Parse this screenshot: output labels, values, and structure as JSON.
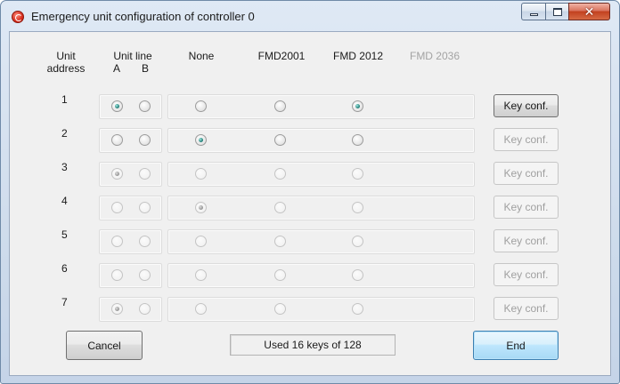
{
  "window": {
    "title": "Emergency unit configuration of controller 0",
    "accent_color": "#c5d4e8",
    "close_color": "#c2401f"
  },
  "headers": {
    "unit_address_line1": "Unit",
    "unit_address_line2": "address",
    "unit_line": "Unit line",
    "line_a": "A",
    "line_b": "B",
    "type_none": "None",
    "type_fmd2001": "FMD2001",
    "type_fmd2012": "FMD 2012",
    "type_fmd2036": "FMD 2036"
  },
  "rows": [
    {
      "address": "1",
      "unit_line": "A",
      "type": "FMD 2012",
      "enabled": true,
      "key_conf_label": "Key conf.",
      "key_conf_enabled": true
    },
    {
      "address": "2",
      "unit_line": "",
      "type": "None",
      "enabled": true,
      "key_conf_label": "Key conf.",
      "key_conf_enabled": false
    },
    {
      "address": "3",
      "unit_line": "A",
      "type": "",
      "enabled": false,
      "key_conf_label": "Key conf.",
      "key_conf_enabled": false
    },
    {
      "address": "4",
      "unit_line": "",
      "type": "None",
      "enabled": false,
      "key_conf_label": "Key conf.",
      "key_conf_enabled": false
    },
    {
      "address": "5",
      "unit_line": "",
      "type": "",
      "enabled": false,
      "key_conf_label": "Key conf.",
      "key_conf_enabled": false
    },
    {
      "address": "6",
      "unit_line": "",
      "type": "",
      "enabled": false,
      "key_conf_label": "Key conf.",
      "key_conf_enabled": false
    },
    {
      "address": "7",
      "unit_line": "A",
      "type": "",
      "enabled": false,
      "key_conf_label": "Key conf.",
      "key_conf_enabled": false
    }
  ],
  "footer": {
    "cancel_label": "Cancel",
    "status_text": "Used 16 keys of 128",
    "end_label": "End"
  }
}
